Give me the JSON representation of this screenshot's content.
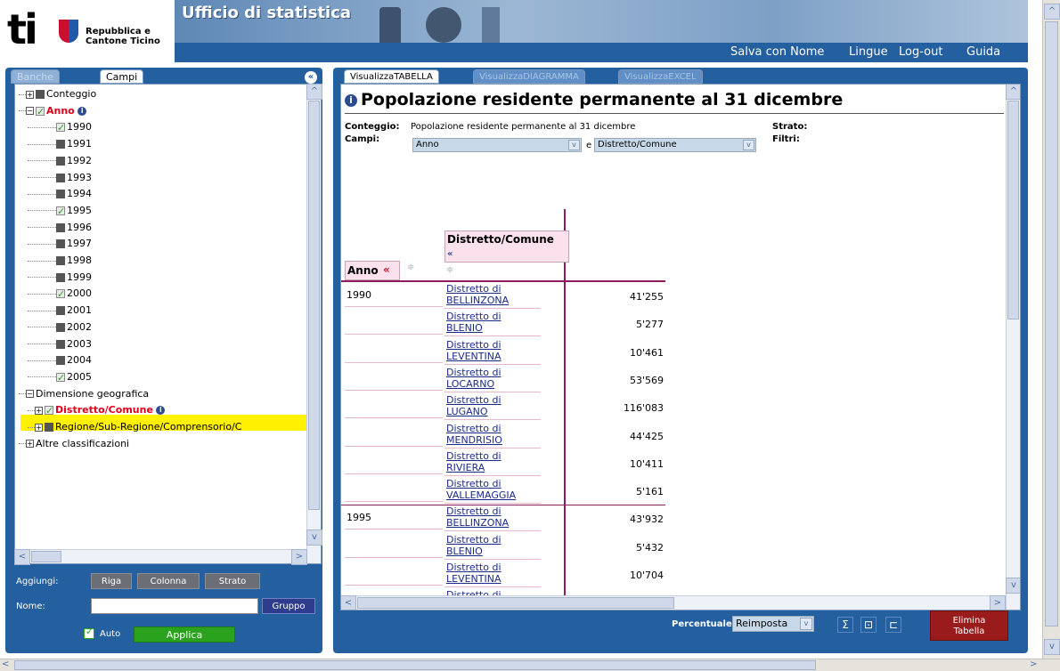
{
  "header": {
    "logo_text": "ti",
    "logo_sub1": "Repubblica e",
    "logo_sub2": "Cantone Ticino",
    "banner_title": "Ufficio di statistica",
    "nav": [
      "Salva con Nome",
      "Lingue",
      "Log-out",
      "Guida"
    ]
  },
  "left": {
    "tabs": [
      "Banche dati",
      "Campi"
    ],
    "tree": [
      {
        "label": "Conteggio",
        "check": "off",
        "expander": "+",
        "level": 1
      },
      {
        "label": "Anno",
        "check": "on",
        "expander": "-",
        "level": 1,
        "red": true,
        "info": true
      },
      {
        "label": "1990",
        "check": "green",
        "level": 2
      },
      {
        "label": "1991",
        "check": "off",
        "level": 2
      },
      {
        "label": "1992",
        "check": "off",
        "level": 2
      },
      {
        "label": "1993",
        "check": "off",
        "level": 2
      },
      {
        "label": "1994",
        "check": "off",
        "level": 2
      },
      {
        "label": "1995",
        "check": "green",
        "level": 2
      },
      {
        "label": "1996",
        "check": "off",
        "level": 2
      },
      {
        "label": "1997",
        "check": "off",
        "level": 2
      },
      {
        "label": "1998",
        "check": "off",
        "level": 2
      },
      {
        "label": "1999",
        "check": "off",
        "level": 2
      },
      {
        "label": "2000",
        "check": "green",
        "level": 2
      },
      {
        "label": "2001",
        "check": "off",
        "level": 2
      },
      {
        "label": "2002",
        "check": "off",
        "level": 2
      },
      {
        "label": "2003",
        "check": "off",
        "level": 2
      },
      {
        "label": "2004",
        "check": "off",
        "level": 2
      },
      {
        "label": "2005",
        "check": "green",
        "level": 2
      },
      {
        "label": "Dimensione geografica",
        "check": "none",
        "expander": "-",
        "level": 1
      },
      {
        "label": "Distretto/Comune",
        "check": "green",
        "expander": "+",
        "level": 2,
        "red": true,
        "info": true,
        "highlight": true
      },
      {
        "label": "Regione/Sub-Regione/Comprensorio/C",
        "check": "off",
        "expander": "+",
        "level": 2
      },
      {
        "label": "Altre classificazioni",
        "check": "none",
        "expander": "+",
        "level": 0
      }
    ],
    "aggiungi_label": "Aggiungi:",
    "buttons": [
      "Riga",
      "Colonna",
      "Strato"
    ],
    "nome_label": "Nome:",
    "nome_value": "",
    "gruppo_label": "Gruppo",
    "auto_label": "Auto",
    "applica_label": "Applica"
  },
  "main": {
    "tabs": [
      "VisualizzaTABELLA",
      "VisualizzaDIAGRAMMA",
      "VisualizzaEXCEL"
    ],
    "title": "Popolazione residente permanente al 31 dicembre",
    "conteggio_label": "Conteggio:",
    "conteggio_value": "Popolazione residente permanente al 31 dicembre",
    "campi_label": "Campi:",
    "campo1": "Anno",
    "e_label": "e",
    "campo2": "Distretto/Comune",
    "strato_label": "Strato:",
    "filtri_label": "Filtri:",
    "col_header": "Distretto/Comune",
    "col_header_arrow": "«",
    "row_header": "Anno",
    "row_header_arrow": "«",
    "sort_symbol": "≑",
    "rows": [
      {
        "year": "1990",
        "prefix": "Distretto di",
        "name": "BELLINZONA",
        "value": "41'255"
      },
      {
        "year": "",
        "prefix": "Distretto di",
        "name": "BLENIO",
        "value": "5'277"
      },
      {
        "year": "",
        "prefix": "Distretto di",
        "name": "LEVENTINA",
        "value": "10'461"
      },
      {
        "year": "",
        "prefix": "Distretto di",
        "name": "LOCARNO",
        "value": "53'569"
      },
      {
        "year": "",
        "prefix": "Distretto di",
        "name": "LUGANO",
        "value": "116'083"
      },
      {
        "year": "",
        "prefix": "Distretto di",
        "name": "MENDRISIO",
        "value": "44'425"
      },
      {
        "year": "",
        "prefix": "Distretto di",
        "name": "RIVIERA",
        "value": "10'411"
      },
      {
        "year": "",
        "prefix": "Distretto di",
        "name": "VALLEMAGGIA",
        "value": "5'161"
      },
      {
        "year": "1995",
        "prefix": "Distretto di",
        "name": "BELLINZONA",
        "value": "43'932"
      },
      {
        "year": "",
        "prefix": "Distretto di",
        "name": "BLENIO",
        "value": "5'432"
      },
      {
        "year": "",
        "prefix": "Distretto di",
        "name": "LEVENTINA",
        "value": "10'704"
      },
      {
        "year": "",
        "prefix": "Distretto di",
        "name": "",
        "value": ""
      }
    ],
    "percentuale_label": "Percentuale:",
    "percentuale_value": "Reimposta",
    "elimina_line1": "Elimina",
    "elimina_line2": "Tabella"
  },
  "colors": {
    "panel_blue": "#245fa0",
    "highlight": "#fff100",
    "accent_red": "#9a1b1b",
    "green": "#2aa21e"
  }
}
